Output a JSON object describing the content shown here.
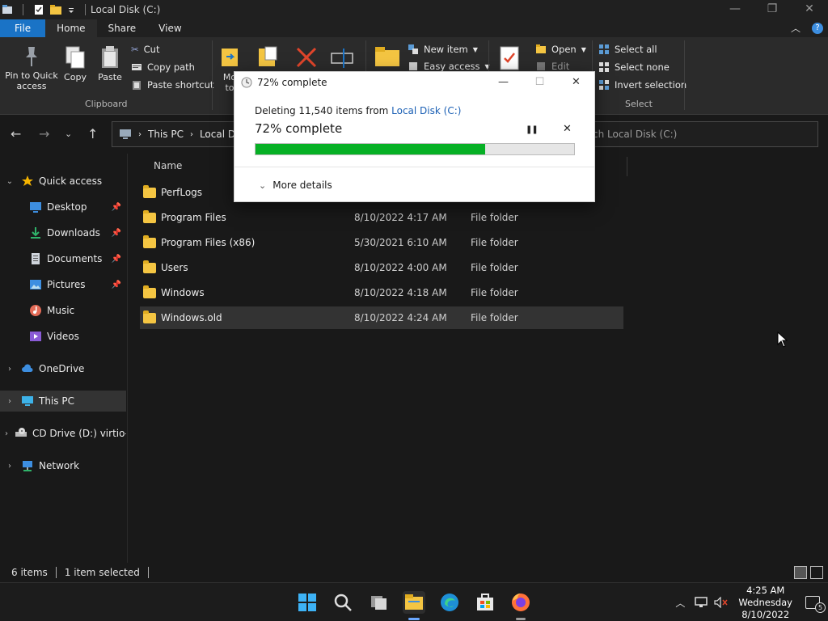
{
  "window": {
    "title": "Local Disk (C:)"
  },
  "tabs": [
    {
      "label": "File"
    },
    {
      "label": "Home"
    },
    {
      "label": "Share"
    },
    {
      "label": "View"
    }
  ],
  "ribbon": {
    "pin_label_1": "Pin to Quick",
    "pin_label_2": "access",
    "copy": "Copy",
    "paste": "Paste",
    "cut": "Cut",
    "copy_path": "Copy path",
    "paste_shortcut": "Paste shortcut",
    "clipboard_group": "Clipboard",
    "move_to_1": "Mo",
    "move_to_2": "to",
    "new_item": "New item",
    "easy_access": "Easy access",
    "open": "Open",
    "edit": "Edit",
    "select_all": "Select all",
    "select_none": "Select none",
    "invert_selection": "Invert selection",
    "select_group": "Select"
  },
  "address": {
    "crumb_1": "This PC",
    "crumb_2": "Local Dis",
    "search_placeholder": "ch Local Disk (C:)"
  },
  "nav": {
    "quick_access": "Quick access",
    "desktop": "Desktop",
    "downloads": "Downloads",
    "documents": "Documents",
    "pictures": "Pictures",
    "music": "Music",
    "videos": "Videos",
    "onedrive": "OneDrive",
    "this_pc": "This PC",
    "cd_drive": "CD Drive (D:) virtio-w",
    "network": "Network"
  },
  "columns": {
    "name": "Name"
  },
  "files": [
    {
      "name": "PerfLogs",
      "date": "",
      "type": ""
    },
    {
      "name": "Program Files",
      "date": "8/10/2022 4:17 AM",
      "type": "File folder"
    },
    {
      "name": "Program Files (x86)",
      "date": "5/30/2021 6:10 AM",
      "type": "File folder"
    },
    {
      "name": "Users",
      "date": "8/10/2022 4:00 AM",
      "type": "File folder"
    },
    {
      "name": "Windows",
      "date": "8/10/2022 4:18 AM",
      "type": "File folder"
    },
    {
      "name": "Windows.old",
      "date": "8/10/2022 4:24 AM",
      "type": "File folder"
    }
  ],
  "status": {
    "items": "6 items",
    "selected": "1 item selected"
  },
  "dialog": {
    "title": "72% complete",
    "line1_prefix": "Deleting 11,540 items from ",
    "line1_link": "Local Disk (C:)",
    "percent_text": "72% complete",
    "progress": 0.72,
    "more_details": "More details"
  },
  "clock": {
    "time": "4:25 AM",
    "day": "Wednesday",
    "date": "8/10/2022"
  },
  "notifications": {
    "count": "5"
  },
  "colors": {
    "accent": "#1a73c6",
    "progress_fill": "#06b025",
    "link": "#1a5fb4"
  }
}
